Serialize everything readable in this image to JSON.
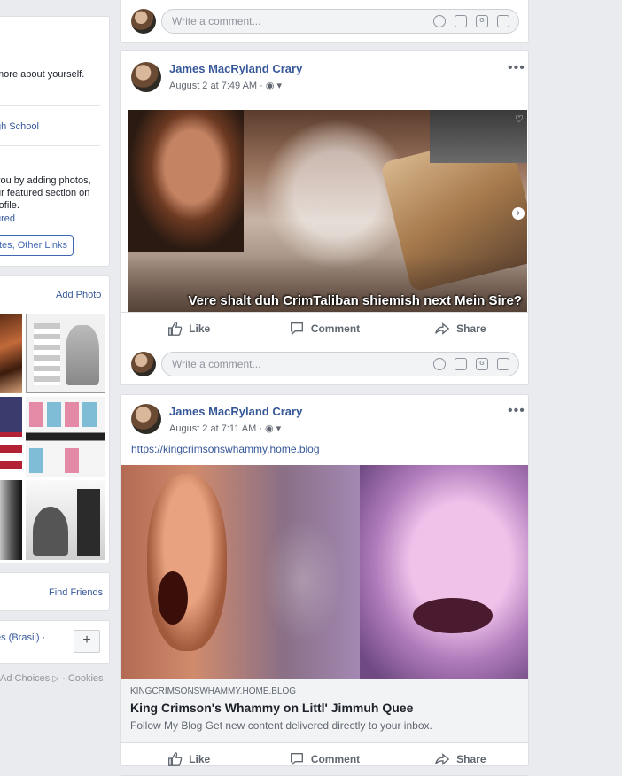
{
  "left": {
    "intro": {
      "line1": "more about yourself.",
      "school": "gh School",
      "featured_lines": [
        "you by adding photos,",
        "ur featured section on",
        "rofile."
      ],
      "featured_link": "ured",
      "chip": "ites, Other Links"
    },
    "photos": {
      "add_photo": "Add Photo"
    },
    "friends": {
      "find_friends": "Find Friends"
    },
    "language": {
      "current": "ês (Brasil) ·",
      "add_symbol": "+"
    },
    "footer": {
      "ad_choices": "Ad Choices",
      "cookies": "· Cookies"
    }
  },
  "composer": {
    "placeholder": "Write a comment..."
  },
  "posts": [
    {
      "author": "James MacRyland Crary",
      "date": "August 2 at 7:49 AM",
      "photo_caption": "Vere shalt duh CrimTaliban shiemish next Mein Sire?",
      "actions": {
        "like": "Like",
        "comment": "Comment",
        "share": "Share"
      }
    },
    {
      "author": "James MacRyland Crary",
      "date": "August 2 at 7:11 AM",
      "text_link": "https://kingcrimsonswhammy.home.blog",
      "link_preview": {
        "domain": "KINGCRIMSONSWHAMMY.HOME.BLOG",
        "title": "King Crimson's Whammy on Littl' Jimmuh Quee",
        "description": "Follow My Blog Get new content delivered directly to your inbox."
      },
      "actions": {
        "like": "Like",
        "comment": "Comment",
        "share": "Share"
      }
    }
  ],
  "colors": {
    "link": "#365899",
    "page_bg": "#e9ebee",
    "meta": "#616770"
  }
}
